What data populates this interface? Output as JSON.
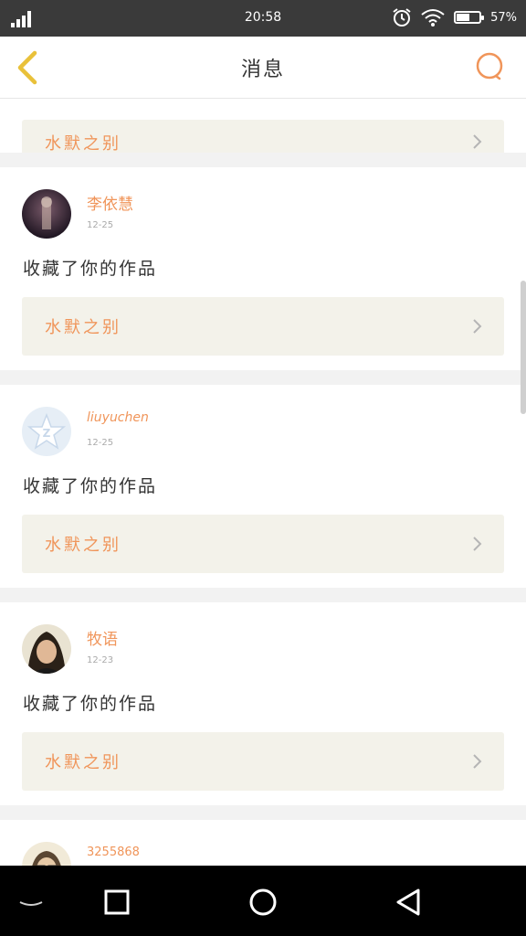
{
  "status_bar": {
    "time": "20:58",
    "battery_percent": "57%",
    "battery_level": 0.57
  },
  "header": {
    "title": "消息",
    "back_icon": "chevron-left-icon",
    "search_icon": "search-icon"
  },
  "colors": {
    "accent": "#f0955a",
    "back_arrow": "#e9c13a",
    "work_box_bg": "#f3f2ea"
  },
  "notifications": [
    {
      "user": "",
      "date": "",
      "action": "",
      "work_title": "水默之别"
    },
    {
      "user": "李依慧",
      "date": "12-25",
      "action": "收藏了你的作品",
      "work_title": "水默之别"
    },
    {
      "user": "liuyuchen",
      "date": "12-25",
      "action": "收藏了你的作品",
      "work_title": "水默之别"
    },
    {
      "user": "牧语",
      "date": "12-23",
      "action": "收藏了你的作品",
      "work_title": "水默之别"
    },
    {
      "user": "3255868",
      "date": "",
      "action": "",
      "work_title": ""
    }
  ]
}
